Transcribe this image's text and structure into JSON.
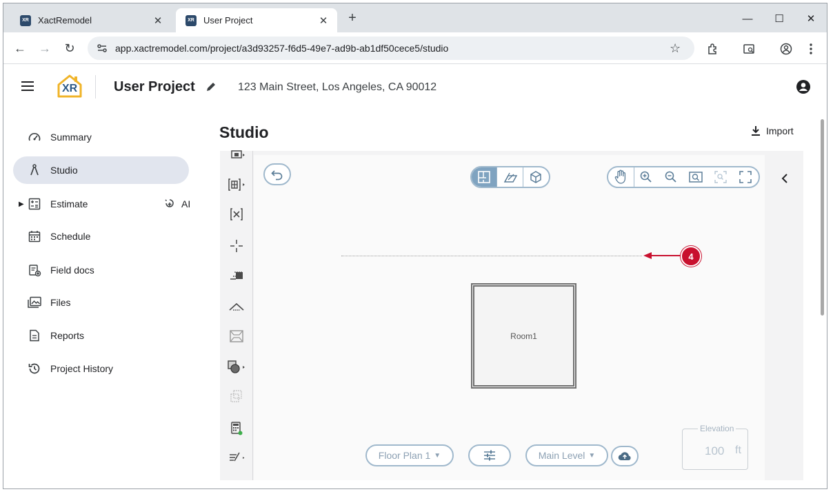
{
  "browser": {
    "tabs": [
      {
        "title": "XactRemodel",
        "favicon": "XR"
      },
      {
        "title": "User Project",
        "favicon": "XR"
      }
    ],
    "url": "app.xactremodel.com/project/a3d93257-f6d5-49e7-ad9b-ab1df50cece5/studio"
  },
  "header": {
    "logo_text": "XR",
    "project_title": "User Project",
    "address": "123 Main Street, Los Angeles, CA 90012"
  },
  "sidebar": {
    "items": [
      {
        "label": "Summary",
        "icon": "gauge-icon"
      },
      {
        "label": "Studio",
        "icon": "compass-icon"
      },
      {
        "label": "Estimate",
        "icon": "calculator-icon"
      },
      {
        "label": "Schedule",
        "icon": "calendar-icon"
      },
      {
        "label": "Field docs",
        "icon": "clipboard-icon"
      },
      {
        "label": "Files",
        "icon": "images-icon"
      },
      {
        "label": "Reports",
        "icon": "document-icon"
      },
      {
        "label": "Project History",
        "icon": "history-icon"
      }
    ],
    "ai_label": "AI"
  },
  "main": {
    "title": "Studio",
    "import_label": "Import",
    "callout_number": "4",
    "room_label": "Room1",
    "floor_plan_label": "Floor Plan 1",
    "level_label": "Main Level",
    "elevation_label": "Elevation",
    "elevation_value": "100",
    "elevation_unit": "ft"
  },
  "colors": {
    "accent": "#7fa3c0",
    "callout": "#c8102e",
    "logo": "#f0b429"
  }
}
